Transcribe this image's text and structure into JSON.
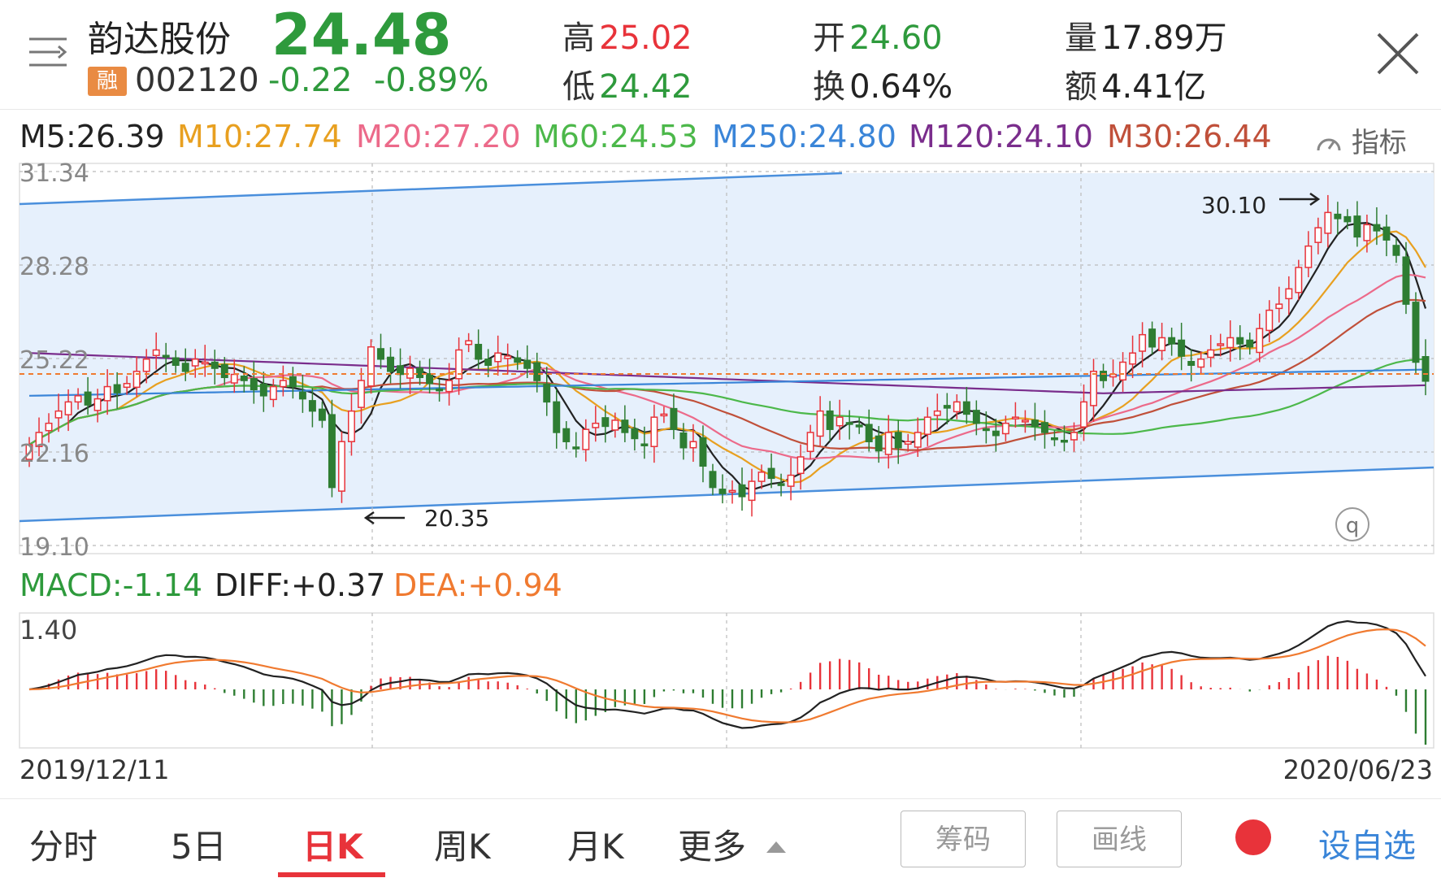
{
  "header": {
    "stock_name": "韵达股份",
    "badge": "融",
    "stock_code": "002120",
    "price": "24.48",
    "change": "-0.22",
    "change_pct": "-0.89%",
    "stats": [
      {
        "label": "高",
        "value": "25.02",
        "color": "#e8333a"
      },
      {
        "label": "低",
        "value": "24.42",
        "color": "#2e9a3c"
      },
      {
        "label": "开",
        "value": "24.60",
        "color": "#2e9a3c"
      },
      {
        "label": "换",
        "value": "0.64%",
        "color": "#222222"
      },
      {
        "label": "量",
        "value": "17.89万",
        "color": "#222222"
      },
      {
        "label": "额",
        "value": "4.41亿",
        "color": "#222222"
      }
    ]
  },
  "ma_legend": [
    {
      "text": "M5:26.39",
      "color": "#222222"
    },
    {
      "text": "M10:27.74",
      "color": "#e8a020"
    },
    {
      "text": "M20:27.20",
      "color": "#ec6a8a"
    },
    {
      "text": "M60:24.53",
      "color": "#4cb84a"
    },
    {
      "text": "M250:24.80",
      "color": "#3a85d8"
    },
    {
      "text": "M120:24.10",
      "color": "#7a2d8c"
    },
    {
      "text": "M30:26.44",
      "color": "#c0503a"
    }
  ],
  "indicator_label": "指标",
  "price_axis": [
    "31.34",
    "28.28",
    "25.22",
    "22.16",
    "19.10"
  ],
  "annotations": {
    "high": "30.10",
    "low": "20.35"
  },
  "badge_q": "q",
  "macd_legend": [
    {
      "text": "MACD:-1.14",
      "color": "#2e9a3c"
    },
    {
      "text": "DIFF:+0.37",
      "color": "#222222"
    },
    {
      "text": "DEA:+0.94",
      "color": "#f07a30"
    }
  ],
  "macd_axis_top": "1.40",
  "dates": {
    "start": "2019/12/11",
    "end": "2020/06/23"
  },
  "bottom_tabs": [
    "分时",
    "5日",
    "日K",
    "周K",
    "月K",
    "更多"
  ],
  "active_tab": "日K",
  "tool_buttons": [
    "筹码",
    "画线"
  ],
  "add_watchlist": "设自选",
  "colors": {
    "up": "#e8333a",
    "down": "#2e7d32",
    "channel_fill": "#e6f0fc",
    "channel_line": "#4a8fdc"
  },
  "chart_data": [
    {
      "type": "candlestick",
      "ylim": [
        19.1,
        31.34
      ],
      "yticks": [
        31.34,
        28.28,
        25.22,
        22.16,
        19.1
      ],
      "x_start": "2019/12/11",
      "x_end": "2020/06/23",
      "grid": true,
      "closes": [
        22.4,
        22.8,
        23.1,
        23.5,
        23.8,
        24.0,
        23.7,
        23.9,
        24.3,
        24.1,
        24.4,
        24.8,
        25.2,
        25.5,
        25.3,
        25.0,
        24.8,
        25.2,
        25.1,
        24.9,
        24.6,
        24.7,
        24.5,
        24.2,
        24.0,
        24.3,
        24.5,
        24.3,
        23.9,
        23.5,
        23.2,
        21.0,
        22.5,
        23.5,
        24.5,
        25.6,
        25.2,
        24.8,
        24.7,
        24.9,
        24.6,
        24.4,
        24.2,
        24.5,
        25.5,
        25.8,
        25.2,
        25.0,
        25.4,
        25.3,
        25.1,
        24.9,
        24.5,
        23.8,
        22.8,
        22.5,
        22.3,
        22.9,
        23.1,
        23.0,
        23.2,
        22.8,
        22.6,
        22.4,
        23.3,
        23.4,
        22.9,
        22.3,
        22.5,
        21.7,
        21.0,
        20.8,
        20.9,
        20.7,
        21.2,
        21.5,
        21.3,
        21.1,
        21.4,
        22.0,
        22.8,
        23.5,
        22.9,
        23.3,
        23.1,
        23.0,
        22.5,
        22.2,
        22.8,
        22.3,
        22.5,
        22.8,
        23.3,
        23.5,
        23.6,
        23.8,
        23.4,
        23.1,
        22.9,
        22.7,
        23.1,
        23.3,
        23.2,
        23.0,
        22.8,
        22.6,
        22.5,
        22.8,
        23.8,
        24.8,
        24.5,
        24.7,
        25.1,
        25.4,
        26.0,
        25.6,
        25.9,
        25.7,
        25.3,
        25.0,
        25.2,
        25.5,
        25.7,
        25.9,
        25.7,
        25.6,
        26.2,
        26.8,
        27.0,
        27.5,
        28.2,
        28.9,
        29.5,
        30.0,
        29.8,
        29.7,
        29.2,
        29.6,
        29.4,
        29.1,
        28.6,
        27.0,
        25.1,
        24.48
      ],
      "ma_lines": [
        "M5",
        "M10",
        "M20",
        "M30",
        "M60",
        "M120",
        "M250"
      ],
      "annotations": [
        {
          "label": "30.10",
          "note": "high"
        },
        {
          "label": "20.35",
          "note": "low"
        }
      ]
    },
    {
      "type": "bar",
      "name": "MACD",
      "axis_top": 1.4,
      "series": [
        "MACD",
        "DIFF",
        "DEA"
      ]
    }
  ]
}
